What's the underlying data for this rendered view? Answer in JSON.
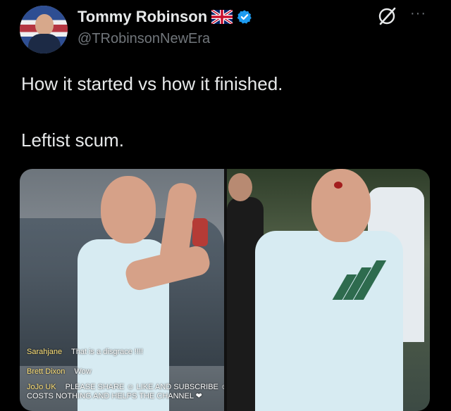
{
  "tweet": {
    "author": {
      "display_name": "Tommy Robinson",
      "handle": "@TRobinsonNewEra",
      "flag_icon": "uk-flag-icon",
      "verified_icon": "verified-badge-icon",
      "verified_color": "#1d9bf0"
    },
    "text_lines": [
      "How it started vs how it finished.",
      "Leftist scum."
    ],
    "menu": {
      "grok_icon": "grok-icon",
      "more_icon": "more-options-icon",
      "more_label": "···"
    },
    "media": {
      "overlay_chat": [
        {
          "user": "Sarahjane",
          "message": "That is a disgrace !!!!"
        },
        {
          "user": "Brett Dixon",
          "message": "Wow"
        },
        {
          "user": "JoJo UK",
          "message": "PLEASE SHARE ☺ LIKE AND SUBSCRIBE ☺"
        },
        {
          "user": "",
          "message": "COSTS NOTHING AND HELPS THE CHANNEL ❤"
        }
      ]
    }
  },
  "colors": {
    "background": "#000000",
    "text": "#e7e9ea",
    "secondary_text": "#71767b"
  }
}
